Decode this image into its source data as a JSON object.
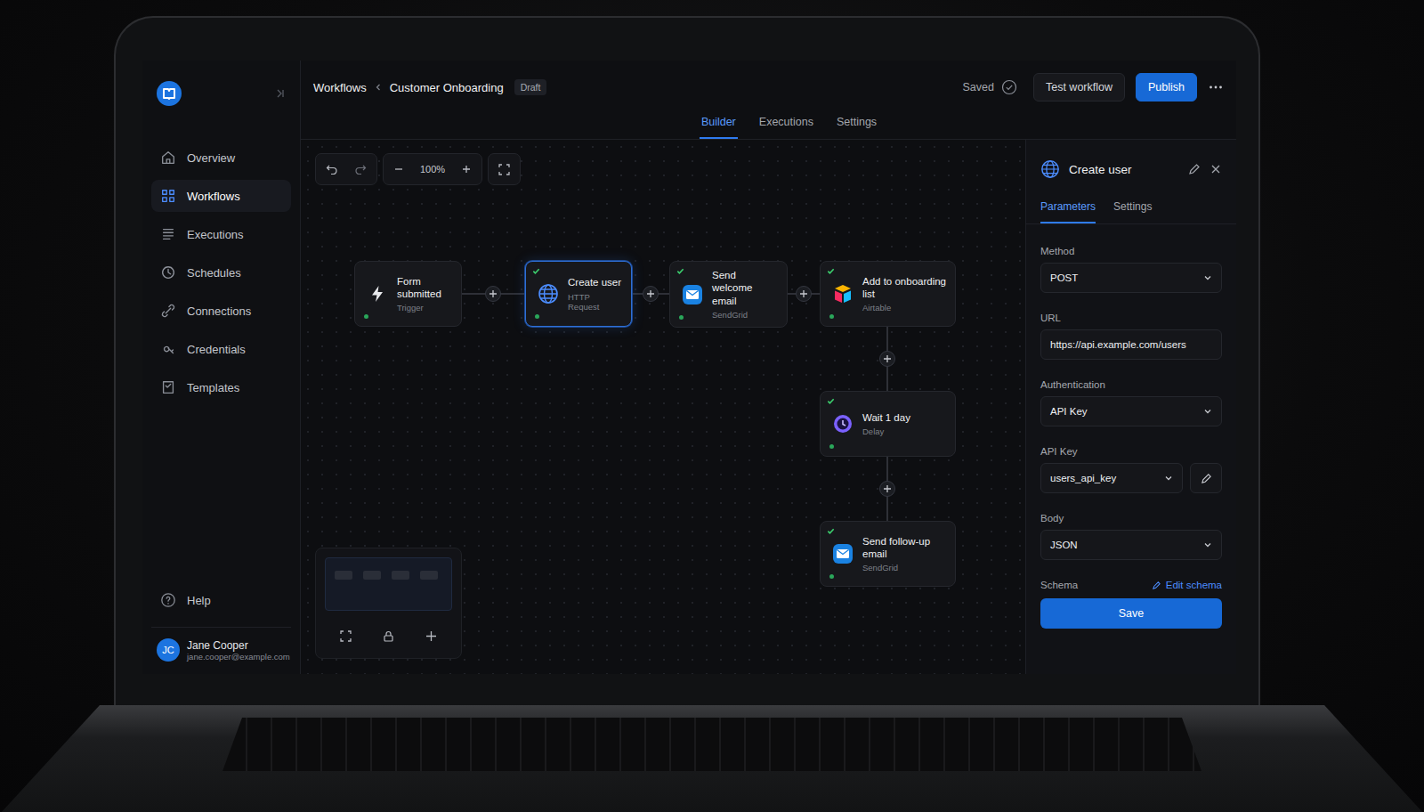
{
  "header": {
    "breadcrumb": [
      {
        "label": "Workflows"
      },
      {
        "label": "Customer Onboarding"
      }
    ],
    "badge": "Draft",
    "save_status": "Saved",
    "buttons": [
      {
        "label": "Test workflow",
        "kind": "secondary"
      },
      {
        "label": "Publish",
        "kind": "primary"
      }
    ]
  },
  "tabs": [
    {
      "label": "Builder",
      "selected": true
    },
    {
      "label": "Executions",
      "selected": false
    },
    {
      "label": "Settings",
      "selected": false
    }
  ],
  "sidebar": {
    "items": [
      {
        "label": "Overview",
        "selected": false
      },
      {
        "label": "Workflows",
        "selected": true
      },
      {
        "label": "Executions",
        "selected": false
      },
      {
        "label": "Schedules",
        "selected": false
      },
      {
        "label": "Connections",
        "selected": false
      },
      {
        "label": "Credentials",
        "selected": false
      },
      {
        "label": "Templates",
        "selected": false
      }
    ],
    "help": "Help",
    "user": {
      "initials": "JC",
      "name": "Jane Cooper",
      "email": "jane.cooper@example.com"
    }
  },
  "toolbar": {
    "zoom": "100%"
  },
  "nodes": [
    {
      "title": "Form submitted",
      "subtitle": "Trigger",
      "kind": "trigger",
      "selected": false,
      "checked": false
    },
    {
      "title": "Create user",
      "subtitle": "HTTP Request",
      "kind": "http",
      "selected": true,
      "checked": true
    },
    {
      "title": "Send welcome email",
      "subtitle": "SendGrid",
      "kind": "email",
      "selected": false,
      "checked": true
    },
    {
      "title": "Add to onboarding list",
      "subtitle": "Airtable",
      "kind": "airtable",
      "selected": false,
      "checked": true
    },
    {
      "title": "Wait 1 day",
      "subtitle": "Delay",
      "kind": "delay",
      "selected": false,
      "checked": true
    },
    {
      "title": "Send follow-up email",
      "subtitle": "SendGrid",
      "kind": "email",
      "selected": false,
      "checked": true
    }
  ],
  "panel": {
    "title": "Create user",
    "tabs": [
      {
        "label": "Parameters",
        "selected": true
      },
      {
        "label": "Settings",
        "selected": false
      }
    ],
    "fields": [
      {
        "label": "Method",
        "value": "POST",
        "kind": "select"
      },
      {
        "label": "URL",
        "value": "https://api.example.com/users",
        "kind": "input"
      },
      {
        "label": "Authentication",
        "value": "API Key",
        "kind": "select"
      },
      {
        "label": "API Key",
        "value": "users_api_key",
        "kind": "select-edit"
      },
      {
        "label": "Body",
        "value": "JSON",
        "kind": "select"
      }
    ],
    "schema": {
      "label": "Schema",
      "link": "Edit schema"
    },
    "save": "Save"
  }
}
